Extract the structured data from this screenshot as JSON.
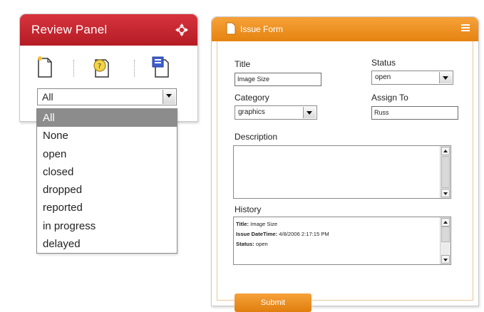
{
  "review_panel": {
    "title": "Review Panel",
    "filter": {
      "selected": "All",
      "options": [
        "All",
        "None",
        "open",
        "closed",
        "dropped",
        "reported",
        "in progress",
        "delayed"
      ]
    }
  },
  "issue_form": {
    "title": "Issue Form",
    "title_label": "Title",
    "title_value": "Image Size",
    "status_label": "Status",
    "status_value": "open",
    "category_label": "Category",
    "category_value": "graphics",
    "assign_label": "Assign To",
    "assign_value": "Russ",
    "description_label": "Description",
    "description_value": "",
    "history_label": "History",
    "history": [
      {
        "key": "Title:",
        "value": "Image Size"
      },
      {
        "key": "Issue DateTime:",
        "value": "4/8/2006 2:17:15 PM"
      },
      {
        "key": "Status:",
        "value": "open"
      }
    ],
    "submit_label": "Submit"
  },
  "colors": {
    "review_header": "#c8262f",
    "form_header": "#f0961f",
    "selected_option": "#8c8c8c"
  }
}
